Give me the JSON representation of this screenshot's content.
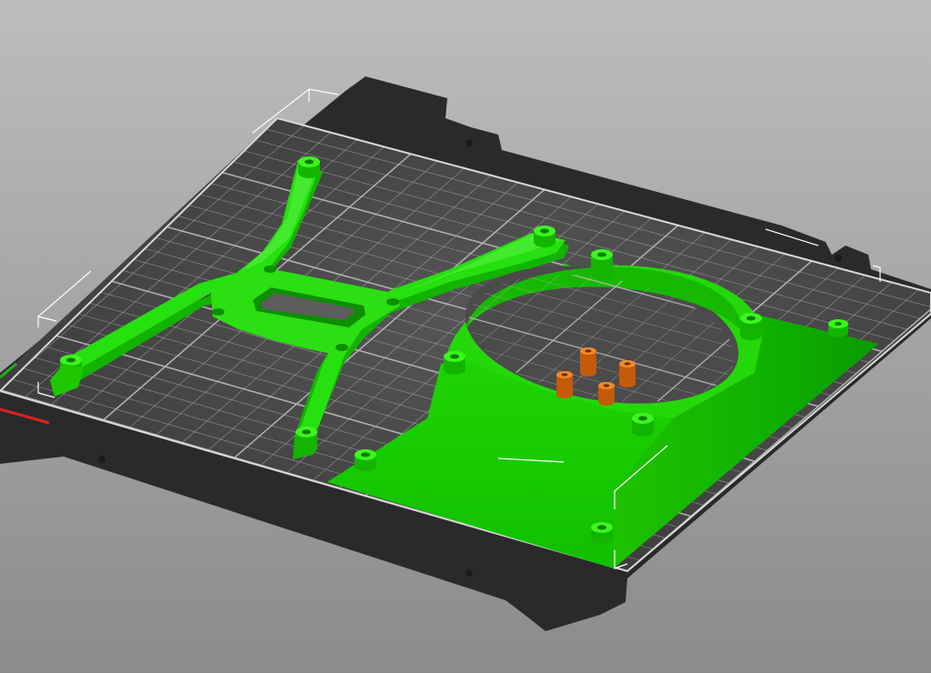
{
  "scene": {
    "background_top": "#bdbdbd",
    "background_bottom": "#8b8b8b",
    "bed_color": "#2b2b2b",
    "bed_surface_color": "#4a4a4a",
    "grid_color": "#b5b5b5",
    "part_color": "#27e00f",
    "part_dark": "#11a600",
    "part_light": "#5cf247",
    "selected_part_color": "#2bd900",
    "spacer_color": "#d46a10",
    "bounding_box_color": "#ffffff",
    "x_axis_color": "#e02020",
    "y_axis_color": "#20c020"
  },
  "objects": [
    {
      "name": "cross-bracket",
      "selected": false,
      "icon": "bracket-icon"
    },
    {
      "name": "fan-shroud",
      "selected": true,
      "icon": "shroud-icon"
    },
    {
      "name": "spacer-1",
      "selected": false,
      "icon": "cylinder-icon"
    },
    {
      "name": "spacer-2",
      "selected": false,
      "icon": "cylinder-icon"
    },
    {
      "name": "spacer-3",
      "selected": false,
      "icon": "cylinder-icon"
    },
    {
      "name": "spacer-4",
      "selected": false,
      "icon": "cylinder-icon"
    }
  ]
}
